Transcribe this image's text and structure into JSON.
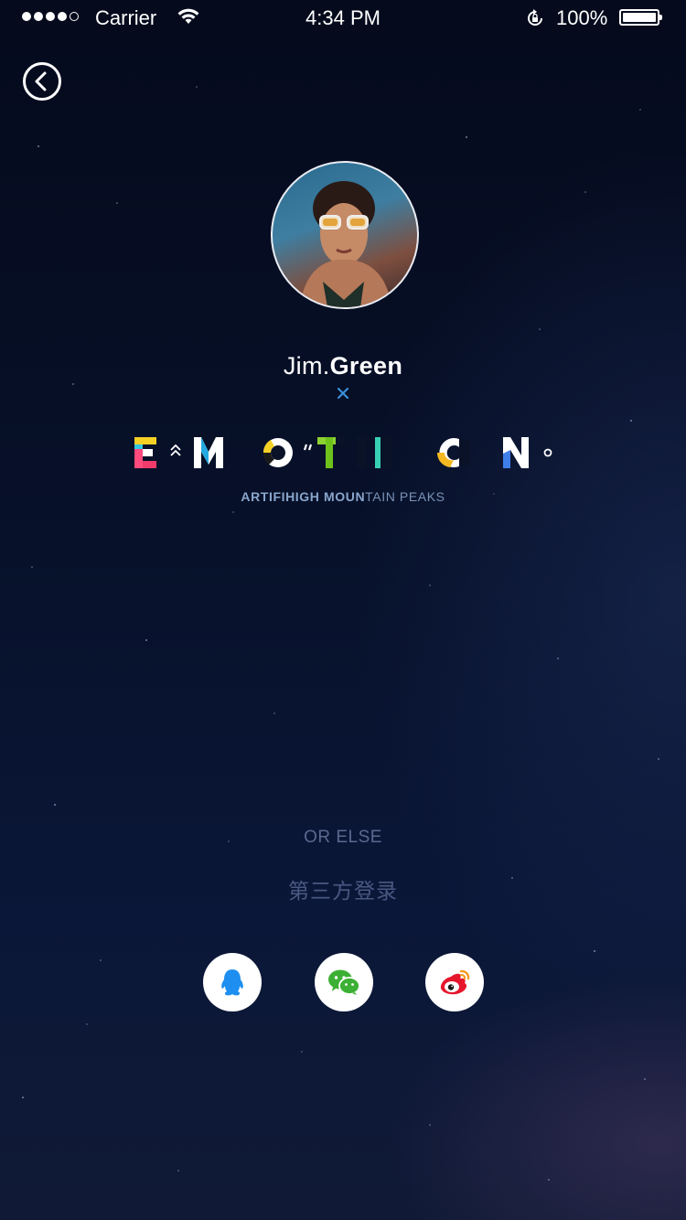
{
  "status_bar": {
    "carrier": "Carrier",
    "time": "4:34 PM",
    "battery": "100%"
  },
  "profile": {
    "first_name": "Jim.",
    "last_name": "Green"
  },
  "logo": {
    "caption_bold": "ARTIFIHIGH MOUN",
    "caption_rest": "TAIN PEAKS"
  },
  "login": {
    "or_else": "OR ELSE",
    "third_party": "第三方登录"
  },
  "icons": {
    "back": "back-arrow-icon",
    "qq": "qq-penguin-icon",
    "wechat": "wechat-icon",
    "weibo": "weibo-icon"
  },
  "colors": {
    "qq": "#1e8ff0",
    "wechat": "#3cb034",
    "weibo": "#e6162d",
    "caption": "#7a93b8"
  }
}
